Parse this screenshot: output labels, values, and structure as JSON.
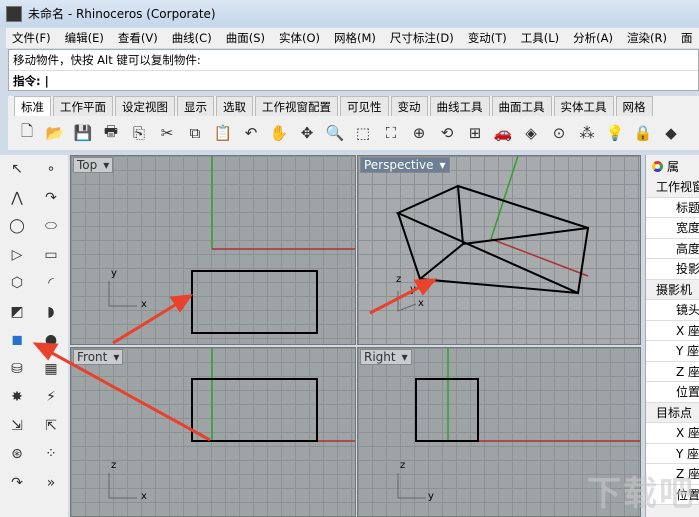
{
  "window": {
    "title": "未命名 - Rhinoceros (Corporate)"
  },
  "menu": [
    "文件(F)",
    "编辑(E)",
    "查看(V)",
    "曲线(C)",
    "曲面(S)",
    "实体(O)",
    "网格(M)",
    "尺寸标注(D)",
    "变动(T)",
    "工具(L)",
    "分析(A)",
    "渲染(R)",
    "面"
  ],
  "command": {
    "history": "移动物件，快按 Alt 键可以复制物件:",
    "prompt": "指令:"
  },
  "tabs": [
    "标准",
    "工作平面",
    "设定视图",
    "显示",
    "选取",
    "工作视窗配置",
    "可见性",
    "变动",
    "曲线工具",
    "曲面工具",
    "实体工具",
    "网格"
  ],
  "toolbar_icons": [
    "new-icon",
    "open-icon",
    "save-icon",
    "print-icon",
    "import-icon",
    "cut-icon",
    "copy-icon",
    "paste-icon",
    "undo-icon",
    "pan-hand-icon",
    "rotate-view-icon",
    "zoom-icon",
    "zoom-window-icon",
    "zoom-extents-icon",
    "zoom-selected-icon",
    "undo-view-icon",
    "four-viewports-icon",
    "car-icon",
    "render-icon",
    "osnap-icon",
    "points-icon",
    "light-icon",
    "lock-icon",
    "material-icon"
  ],
  "left_tools": [
    "select-icon",
    "point-icon",
    "polyline-icon",
    "curve-icon",
    "circle-icon",
    "ellipse-icon",
    "polygon-icon",
    "rectangle-icon",
    "offset-icon",
    "fillet-icon",
    "surface-icon",
    "sweep-icon",
    "box-icon",
    "sphere-icon",
    "cylinder-icon",
    "mesh-icon",
    "explode-icon",
    "boolean-icon",
    "move-icon",
    "transform-icon",
    "group-icon",
    "array-icon",
    "analyze-icon",
    "more-icon"
  ],
  "viewports": [
    {
      "name": "Top",
      "axes": [
        "y",
        "x"
      ]
    },
    {
      "name": "Perspective",
      "axes": [
        "z",
        "y",
        "x"
      ]
    },
    {
      "name": "Front",
      "axes": [
        "z",
        "x"
      ]
    },
    {
      "name": "Right",
      "axes": [
        "z",
        "y"
      ]
    }
  ],
  "properties": {
    "tab": "属",
    "rows": [
      {
        "type": "group",
        "label": "工作视窗"
      },
      {
        "type": "item",
        "label": "标题"
      },
      {
        "type": "item",
        "label": "宽度"
      },
      {
        "type": "item",
        "label": "高度"
      },
      {
        "type": "item",
        "label": "投影"
      },
      {
        "type": "group",
        "label": "摄影机"
      },
      {
        "type": "item",
        "label": "镜头"
      },
      {
        "type": "item",
        "label": "X 座"
      },
      {
        "type": "item",
        "label": "Y 座"
      },
      {
        "type": "item",
        "label": "Z 座"
      },
      {
        "type": "item",
        "label": "位置"
      },
      {
        "type": "group",
        "label": "目标点"
      },
      {
        "type": "item",
        "label": "X 座"
      },
      {
        "type": "item",
        "label": "Y 座"
      },
      {
        "type": "item",
        "label": "Z 座"
      },
      {
        "type": "item",
        "label": "位置"
      }
    ]
  },
  "watermark": "下载吧",
  "colors": {
    "x_axis": "#b03030",
    "y_axis": "#30a030",
    "arrow": "#e8412c"
  }
}
